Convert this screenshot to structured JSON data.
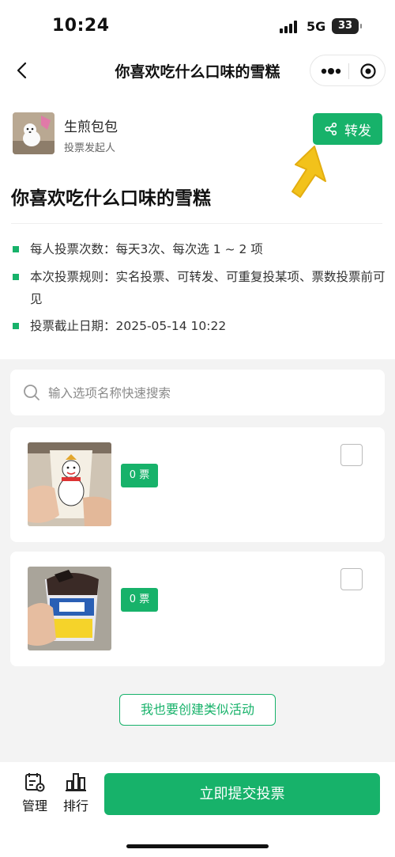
{
  "status_bar": {
    "time": "10:24",
    "network": "5G",
    "battery": "33"
  },
  "nav": {
    "title": "你喜欢吃什么口味的雪糕"
  },
  "initiator": {
    "name": "生煎包包",
    "role": "投票发起人"
  },
  "share_button": {
    "label": "转发"
  },
  "vote": {
    "title": "你喜欢吃什么口味的雪糕",
    "rules": [
      {
        "text": "每人投票次数：每天3次、每次选 1 ~ 2 项"
      },
      {
        "text": "本次投票规则：实名投票、可转发、可重复投某项、票数投票前可见"
      },
      {
        "text": "投票截止日期：2025-05-14 10:22"
      }
    ]
  },
  "search": {
    "placeholder": "输入选项名称快速搜索"
  },
  "options": [
    {
      "votes": "0 票",
      "image": "snowman-ice-cream-cup-photo"
    },
    {
      "votes": "0 票",
      "image": "oreo-sundae-cup-photo"
    }
  ],
  "create_button": {
    "label": "我也要创建类似活动"
  },
  "bottom": {
    "manage_label": "管理",
    "rank_label": "排行",
    "submit_label": "立即提交投票"
  },
  "colors": {
    "accent": "#17b26a",
    "cursor_yellow": "#f2c21b"
  }
}
